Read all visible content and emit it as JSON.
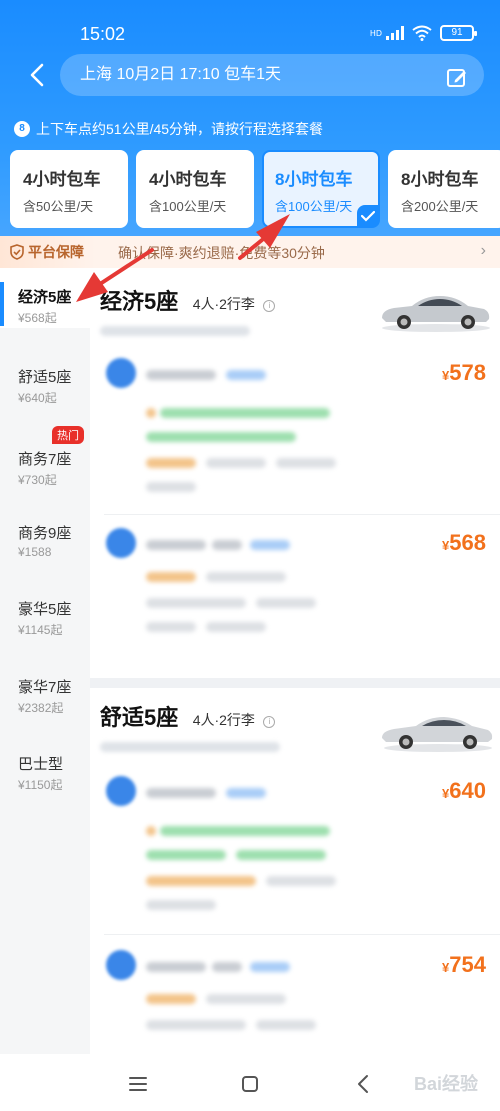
{
  "status": {
    "time": "15:02",
    "battery": "91"
  },
  "search": {
    "text": "上海 10月2日 17:10 包车1天"
  },
  "hint": "上下车点约51公里/45分钟，请按行程选择套餐",
  "packages": [
    {
      "title": "4小时包车",
      "sub": "含50公里/天",
      "selected": false
    },
    {
      "title": "4小时包车",
      "sub": "含100公里/天",
      "selected": false
    },
    {
      "title": "8小时包车",
      "sub": "含100公里/天",
      "selected": true
    },
    {
      "title": "8小时包车",
      "sub": "含200公里/天",
      "selected": false
    }
  ],
  "guarantee": {
    "badge": "平台保障",
    "text": "确认保障·爽约退赔·免费等30分钟"
  },
  "sidebar": [
    {
      "name": "经济5座",
      "price": "¥568起"
    },
    {
      "name": "舒适5座",
      "price": "¥640起"
    },
    {
      "name": "商务7座",
      "price": "¥730起",
      "badge": "热门"
    },
    {
      "name": "商务9座",
      "price": "¥1588"
    },
    {
      "name": "豪华5座",
      "price": "¥1145起"
    },
    {
      "name": "豪华7座",
      "price": "¥2382起"
    },
    {
      "name": "巴士型",
      "price": "¥1150起"
    }
  ],
  "sections": [
    {
      "title": "经济5座",
      "capacity": "4人·2行李",
      "offers": [
        {
          "price": "578"
        },
        {
          "price": "568"
        }
      ]
    },
    {
      "title": "舒适5座",
      "capacity": "4人·2行李",
      "offers": [
        {
          "price": "640"
        },
        {
          "price": "754"
        }
      ]
    }
  ],
  "currency": "¥",
  "watermark": "Bai经验",
  "colors": {
    "brand": "#1a8cff",
    "price": "#f2711c",
    "arrow": "#e53935"
  }
}
